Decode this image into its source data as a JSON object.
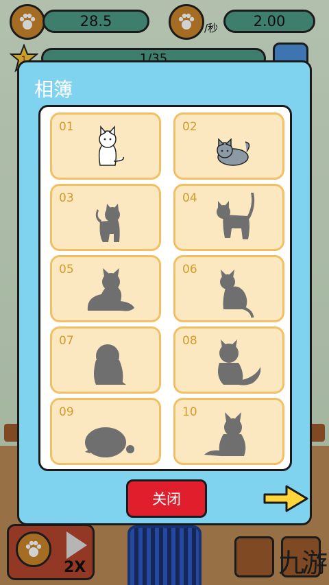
{
  "hud": {
    "coin_total": "28.5",
    "rate_value": "2.00",
    "rate_unit": "/秒",
    "level": "1",
    "progress": "1/35",
    "progress_fraction": 0.029
  },
  "modal": {
    "title": "相簿",
    "close_label": "关闭",
    "next_icon": "right-arrow-icon"
  },
  "cards": [
    {
      "number": "01",
      "status": "unlocked",
      "cat": "white-sitting-cat"
    },
    {
      "number": "02",
      "status": "unlocked",
      "cat": "gray-curled-cat"
    },
    {
      "number": "03",
      "status": "locked",
      "cat": "silhouette-standing"
    },
    {
      "number": "04",
      "status": "locked",
      "cat": "silhouette-tail-up"
    },
    {
      "number": "05",
      "status": "locked",
      "cat": "silhouette-fluffy-lying"
    },
    {
      "number": "06",
      "status": "locked",
      "cat": "silhouette-sitting-long-tail"
    },
    {
      "number": "07",
      "status": "locked",
      "cat": "silhouette-chubby"
    },
    {
      "number": "08",
      "status": "locked",
      "cat": "silhouette-fluffy-tail"
    },
    {
      "number": "09",
      "status": "locked",
      "cat": "silhouette-round"
    },
    {
      "number": "10",
      "status": "locked",
      "cat": "silhouette-longhair"
    }
  ],
  "bottom_bar": {
    "speed_label": "2X",
    "watermark": "九游"
  },
  "colors": {
    "modal_bg": "#7fd3ef",
    "card_bg": "#fce8c0",
    "card_border": "#f2c064",
    "close_button": "#e01e2c",
    "silhouette": "#6f6f6f",
    "next_arrow": "#ffd53a"
  }
}
